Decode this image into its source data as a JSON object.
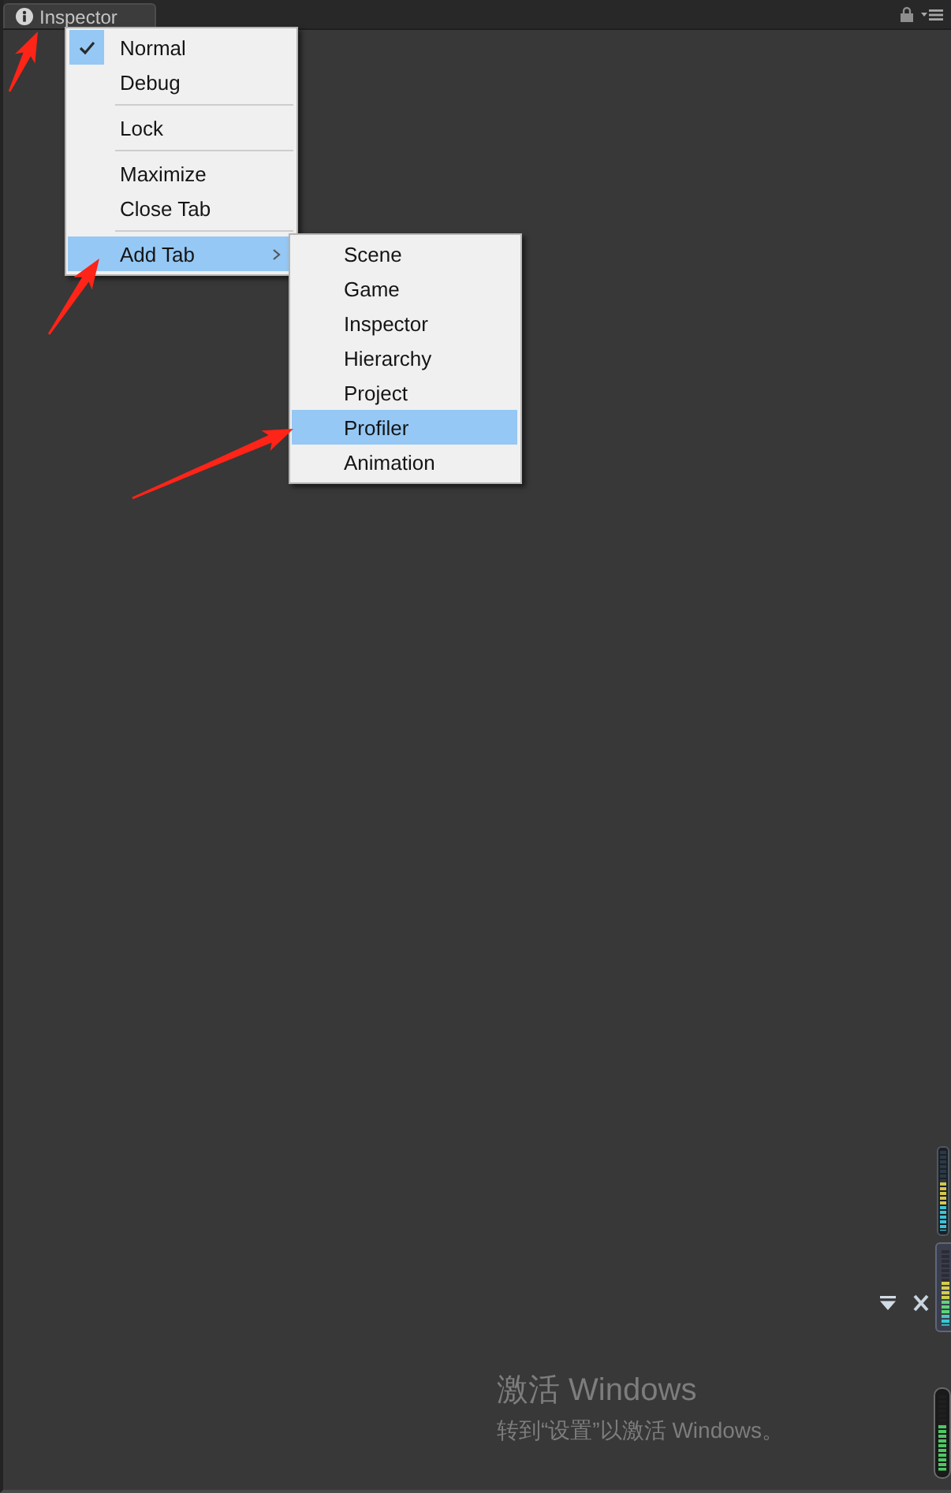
{
  "tab": {
    "label": "Inspector"
  },
  "context_menu": {
    "groups": [
      {
        "items": [
          {
            "label": "Normal",
            "checked": true,
            "highlighted": false,
            "has_submenu": false
          },
          {
            "label": "Debug",
            "checked": false,
            "highlighted": false,
            "has_submenu": false
          }
        ]
      },
      {
        "items": [
          {
            "label": "Lock",
            "checked": false,
            "highlighted": false,
            "has_submenu": false
          }
        ]
      },
      {
        "items": [
          {
            "label": "Maximize",
            "checked": false,
            "highlighted": false,
            "has_submenu": false
          },
          {
            "label": "Close Tab",
            "checked": false,
            "highlighted": false,
            "has_submenu": false
          }
        ]
      },
      {
        "items": [
          {
            "label": "Add Tab",
            "checked": false,
            "highlighted": true,
            "has_submenu": true
          }
        ]
      }
    ]
  },
  "add_tab_submenu": {
    "items": [
      {
        "label": "Scene",
        "highlighted": false
      },
      {
        "label": "Game",
        "highlighted": false
      },
      {
        "label": "Inspector",
        "highlighted": false
      },
      {
        "label": "Hierarchy",
        "highlighted": false
      },
      {
        "label": "Project",
        "highlighted": false
      },
      {
        "label": "Profiler",
        "highlighted": true
      },
      {
        "label": "Animation",
        "highlighted": false
      }
    ]
  },
  "level_meters": [
    {
      "kind": "slim",
      "level": 0.6
    },
    {
      "kind": "panel",
      "level": 0.58
    },
    {
      "kind": "wide",
      "level": 0.6
    }
  ],
  "activation_notice": {
    "title": "激活 Windows",
    "message": "转到“设置”以激活 Windows。"
  }
}
